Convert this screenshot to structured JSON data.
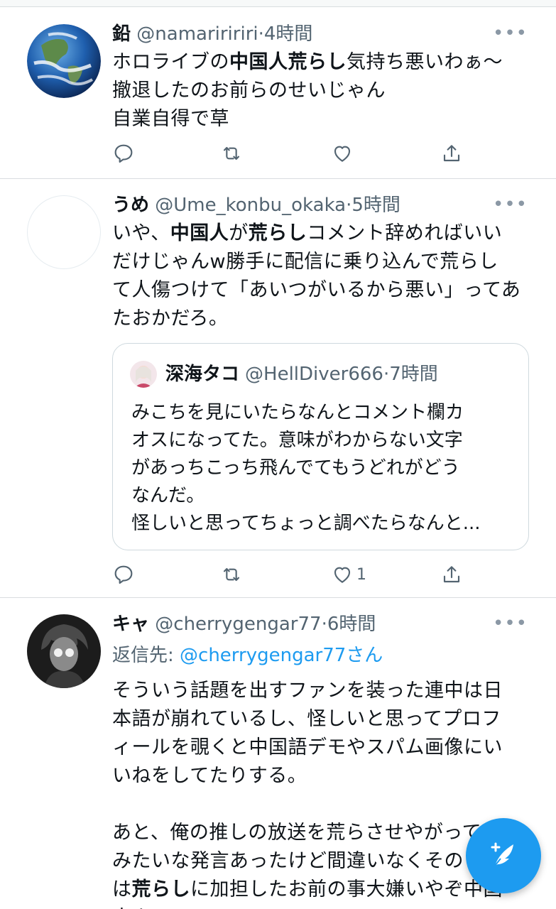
{
  "tweets": [
    {
      "name": "鉛",
      "handle": "@namariririri",
      "dot": "·",
      "time": "4時間",
      "more": "•••",
      "lines": [
        {
          "a": "ホロライブの",
          "b": "中国人荒らし",
          "c": "気持ち悪いわぁ〜"
        },
        {
          "a": "撤退したのお前らのせいじゃん",
          "b": "",
          "c": ""
        },
        {
          "a": "自業自得で草",
          "b": "",
          "c": ""
        }
      ]
    },
    {
      "name": "うめ",
      "handle": "@Ume_konbu_okaka",
      "dot": "·",
      "time": "5時間",
      "more": "•••",
      "lines": [
        {
          "a": "いや、",
          "b": "中国人",
          "c": "が",
          "d": "荒らし",
          "e": "コメント辞めればいい"
        },
        {
          "a": "だけじゃんw勝手に配信に乗り込んで荒らし"
        },
        {
          "a": "て人傷つけて「あいつがいるから悪い」ってあ"
        },
        {
          "a": "たおかだろ。"
        }
      ],
      "quote": {
        "name": "深海タコ",
        "handle": "@HellDiver666",
        "dot": "·",
        "time": "7時間",
        "lines": [
          "みこちを見にいたらなんとコメント欄カ",
          "オスになってた。意味がわからない文字",
          "があっちこっち飛んでてもうどれがどう",
          "なんだ。",
          "怪しいと思ってちょっと調べたらなんと..."
        ]
      },
      "like_count": "1"
    },
    {
      "name": "キャ",
      "handle": "@cherrygengar77",
      "dot": "·",
      "time": "6時間",
      "more": "•••",
      "replying_label": "返信先: ",
      "replying_to": "@cherrygengar77さん",
      "lines": [
        {
          "a": "そういう話題を出すファンを装った連中は日"
        },
        {
          "a": "本語が崩れているし、怪しいと思ってプロフ"
        },
        {
          "a": "ィールを覗くと中国語デモやスパム画像にい"
        },
        {
          "a": "いねをしてたりする。"
        },
        {
          "a": ""
        },
        {
          "a": "あと、俺の推しの放送を荒らさせやがって"
        },
        {
          "a": "みたいな発言あったけど間違いなくその"
        },
        {
          "a": "は",
          "b": "荒らし",
          "c": "に加担したお前の事大嫌いやぞ中国"
        },
        {
          "a": "人よ"
        }
      ]
    }
  ],
  "colors": {
    "accent": "#1d9bf0",
    "muted": "#536471",
    "border": "#d9dde0"
  },
  "icons": [
    "reply-icon",
    "retweet-icon",
    "like-icon",
    "share-icon",
    "compose-tweet-icon"
  ]
}
